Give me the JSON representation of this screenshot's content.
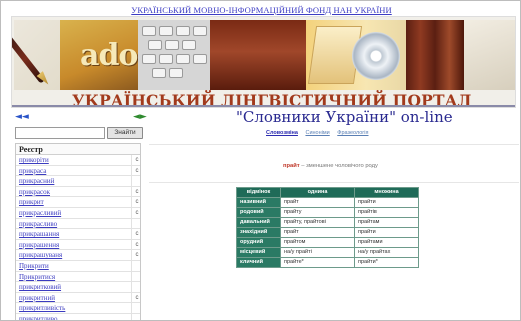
{
  "header": {
    "top_link": "УКРАЇНСЬКИЙ МОВНО-ІНФОРМАЦІЙНИЙ ФОНД НАН УКРАЇНИ",
    "portal_title": "УКРАЇНСЬКИЙ ЛІНГВІСТИЧНИЙ ПОРТАЛ",
    "banner_logo_text": "adobe"
  },
  "nav": {
    "back_icon": "◄◄",
    "forward_icon": "◄►"
  },
  "search": {
    "value": "",
    "button_label": "Знайти"
  },
  "registry": {
    "heading": "Реєстр",
    "items": [
      {
        "word": "прикоріти",
        "mark": "с"
      },
      {
        "word": "прикраса",
        "mark": "с"
      },
      {
        "word": "прикрасний",
        "mark": ""
      },
      {
        "word": "прикрасок",
        "mark": "с"
      },
      {
        "word": "прикрит",
        "mark": "с"
      },
      {
        "word": "прикрасливий",
        "mark": "с"
      },
      {
        "word": "прикрасливо",
        "mark": ""
      },
      {
        "word": "прикрашання",
        "mark": "с"
      },
      {
        "word": "прикрашення",
        "mark": "с"
      },
      {
        "word": "прикрашуваня",
        "mark": "с"
      },
      {
        "word": "Прикрити",
        "mark": ""
      },
      {
        "word": "Прикритися",
        "mark": ""
      },
      {
        "word": "прикритковий",
        "mark": ""
      },
      {
        "word": "прикритний",
        "mark": "с"
      },
      {
        "word": "прикритливість",
        "mark": ""
      },
      {
        "word": "прикритливо",
        "mark": ""
      }
    ]
  },
  "main": {
    "title": "\"Словники України\" on-line",
    "tabs": [
      {
        "label": "Словозміна",
        "active": true
      },
      {
        "label": "Синоніми",
        "active": false
      },
      {
        "label": "Фразеологія",
        "active": false
      }
    ],
    "definition": {
      "word": "прайт",
      "text": " – зменшене чоловічого роду"
    },
    "declension": {
      "headers": [
        "відмінок",
        "однина",
        "множина"
      ],
      "rows": [
        {
          "case": "називний",
          "singular": "прайт",
          "plural": "прайти"
        },
        {
          "case": "родовий",
          "singular": "прайту",
          "plural": "прайтів"
        },
        {
          "case": "давальний",
          "singular": "прайту, прайтові",
          "plural": "прайтам"
        },
        {
          "case": "знахідний",
          "singular": "прайт",
          "plural": "прайти"
        },
        {
          "case": "орудний",
          "singular": "прайтом",
          "plural": "прайтами"
        },
        {
          "case": "місцевий",
          "singular": "на/у прайті",
          "plural": "на/у прайтах"
        },
        {
          "case": "кличний",
          "singular": "прайте*",
          "plural": "прайти*"
        }
      ]
    }
  },
  "colors": {
    "link": "#3b3bc0",
    "title_blue": "#2a2a90",
    "portal_red": "#a23a1c",
    "table_header": "#1f6b58",
    "table_case": "#2a7a64"
  }
}
